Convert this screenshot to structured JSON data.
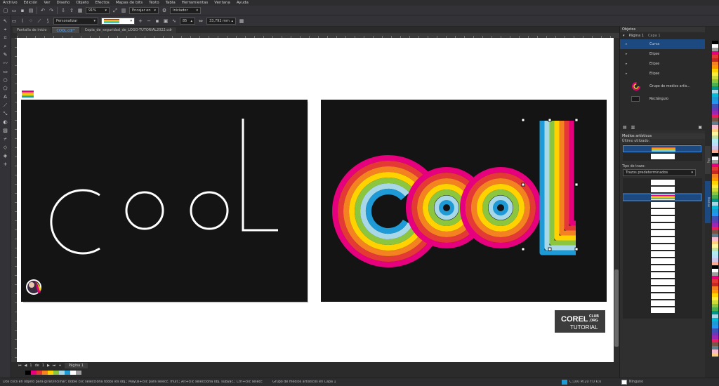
{
  "menubar": [
    "Archivo",
    "Edición",
    "Ver",
    "Diseño",
    "Objeto",
    "Efectos",
    "Mapas de bits",
    "Texto",
    "Tabla",
    "Herramientas",
    "Ventana",
    "Ayuda"
  ],
  "toolbar1": {
    "zoom": "91%",
    "snap": "Encajar en",
    "launcher": "Iniciador"
  },
  "toolbar2": {
    "preset": "Personalizar",
    "stroke_width": "33,792 mm",
    "value": "85"
  },
  "tabs": [
    "Pantalla de inicio",
    "COOL.cdr*",
    "Copia_de_seguridad_de_LOGO-TUTORIAL2022.cdr"
  ],
  "objects_panel": {
    "title": "Objetos",
    "page": "Página 1",
    "layer": "Capa 1",
    "rows": [
      "Curva",
      "Elipse",
      "Elipse",
      "Elipse",
      "Grupo de medios artís...",
      "Rectángulo"
    ]
  },
  "artistic_media": {
    "title": "Medios artísticos",
    "recent": "Último utilizado:",
    "stroke_type": "Tipo de trazo:",
    "preset_strokes": "Trazos predeterminados"
  },
  "canvas": {
    "left_word": "CooL",
    "right_word": "CooL",
    "badge_main": "COREL",
    "badge_club": "CLUB",
    "badge_org": ".ORG",
    "badge_sub": "TUTORIAL"
  },
  "pagebar": {
    "page_num": "1",
    "of": "de",
    "total": "1",
    "page_label": "Página 1"
  },
  "status": {
    "hint": "Dos clics en objeto para girar/inclinar; doble clic selecciona todos los obj.; Mayús+clic para selecc. múlt.; Alt+clic selecciona obj. subyac.; Ctrl+clic selecciona obj. de grupo",
    "selection": "Grupo de medios artísticos en Capa 1",
    "fill": "C:100 M:20 Y:0 K:0",
    "outline": "Ninguno"
  },
  "colors": {
    "accent": "#2b8ce6",
    "rainbow": [
      "#e6007e",
      "#e53935",
      "#f58220",
      "#ffd200",
      "#8cc63f",
      "#a8d8e8",
      "#1e9ad6"
    ]
  }
}
